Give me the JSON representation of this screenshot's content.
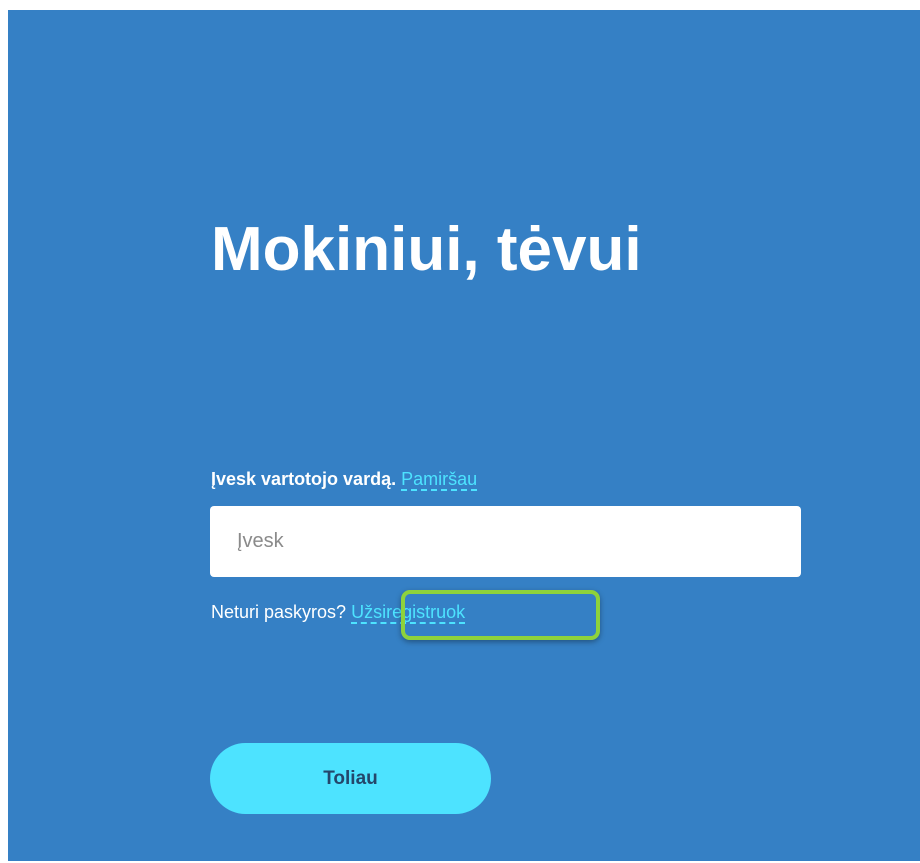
{
  "page": {
    "title": "Mokiniui, tėvui"
  },
  "username": {
    "label": "Įvesk vartotojo vardą.",
    "forgot_link": "Pamiršau",
    "placeholder": "Įvesk",
    "value": ""
  },
  "register": {
    "prompt": "Neturi paskyros?",
    "link": "Užsiregistruok"
  },
  "actions": {
    "next_label": "Toliau"
  },
  "colors": {
    "background": "#3580c5",
    "accent": "#4de3ff",
    "highlight": "#8ed23b",
    "button_text": "#24476b"
  }
}
